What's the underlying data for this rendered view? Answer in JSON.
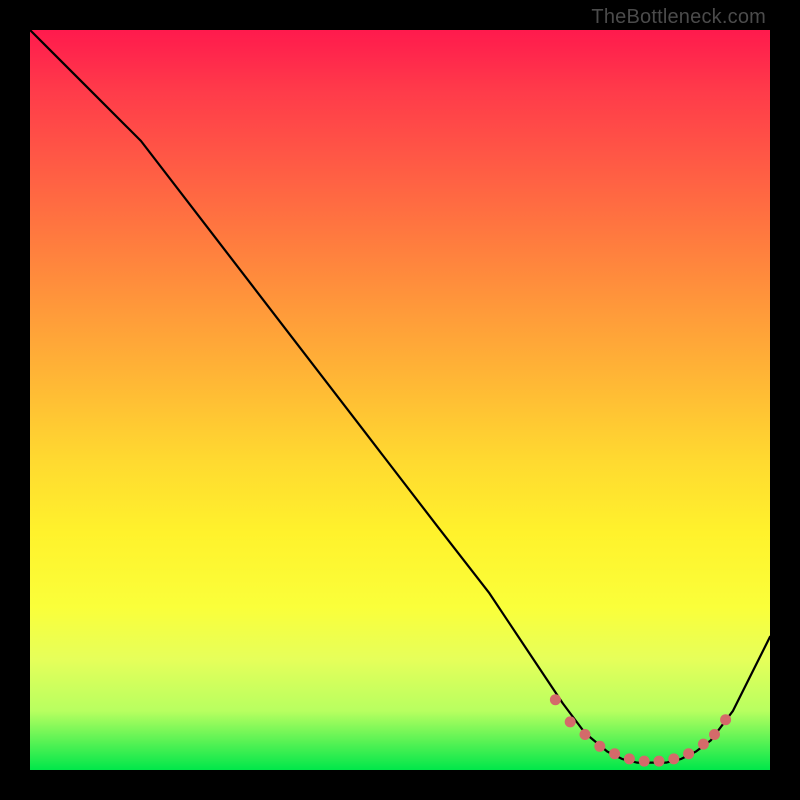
{
  "watermark": "TheBottleneck.com",
  "colors": {
    "frame": "#000000",
    "curve": "#000000",
    "markers": "#d46a6a",
    "gradient_top": "#ff1a4d",
    "gradient_bottom": "#00e74a"
  },
  "chart_data": {
    "type": "line",
    "title": "",
    "xlabel": "",
    "ylabel": "",
    "xlim": [
      0,
      100
    ],
    "ylim": [
      0,
      100
    ],
    "x": [
      0,
      3,
      8,
      15,
      25,
      35,
      45,
      55,
      62,
      68,
      72,
      75,
      78,
      80,
      82,
      84,
      86,
      88,
      90,
      92,
      95,
      98,
      100
    ],
    "y": [
      100,
      97,
      92,
      85,
      72,
      59,
      46,
      33,
      24,
      15,
      9,
      5,
      2.5,
      1.5,
      1,
      1,
      1,
      1.5,
      2.5,
      4,
      8,
      14,
      18
    ],
    "marker_segment": {
      "x": [
        71,
        73,
        75,
        77,
        79,
        81,
        83,
        85,
        87,
        89,
        91,
        92.5,
        94
      ],
      "y": [
        9.5,
        6.5,
        4.8,
        3.2,
        2.2,
        1.5,
        1.2,
        1.2,
        1.5,
        2.2,
        3.5,
        4.8,
        6.8
      ]
    }
  }
}
